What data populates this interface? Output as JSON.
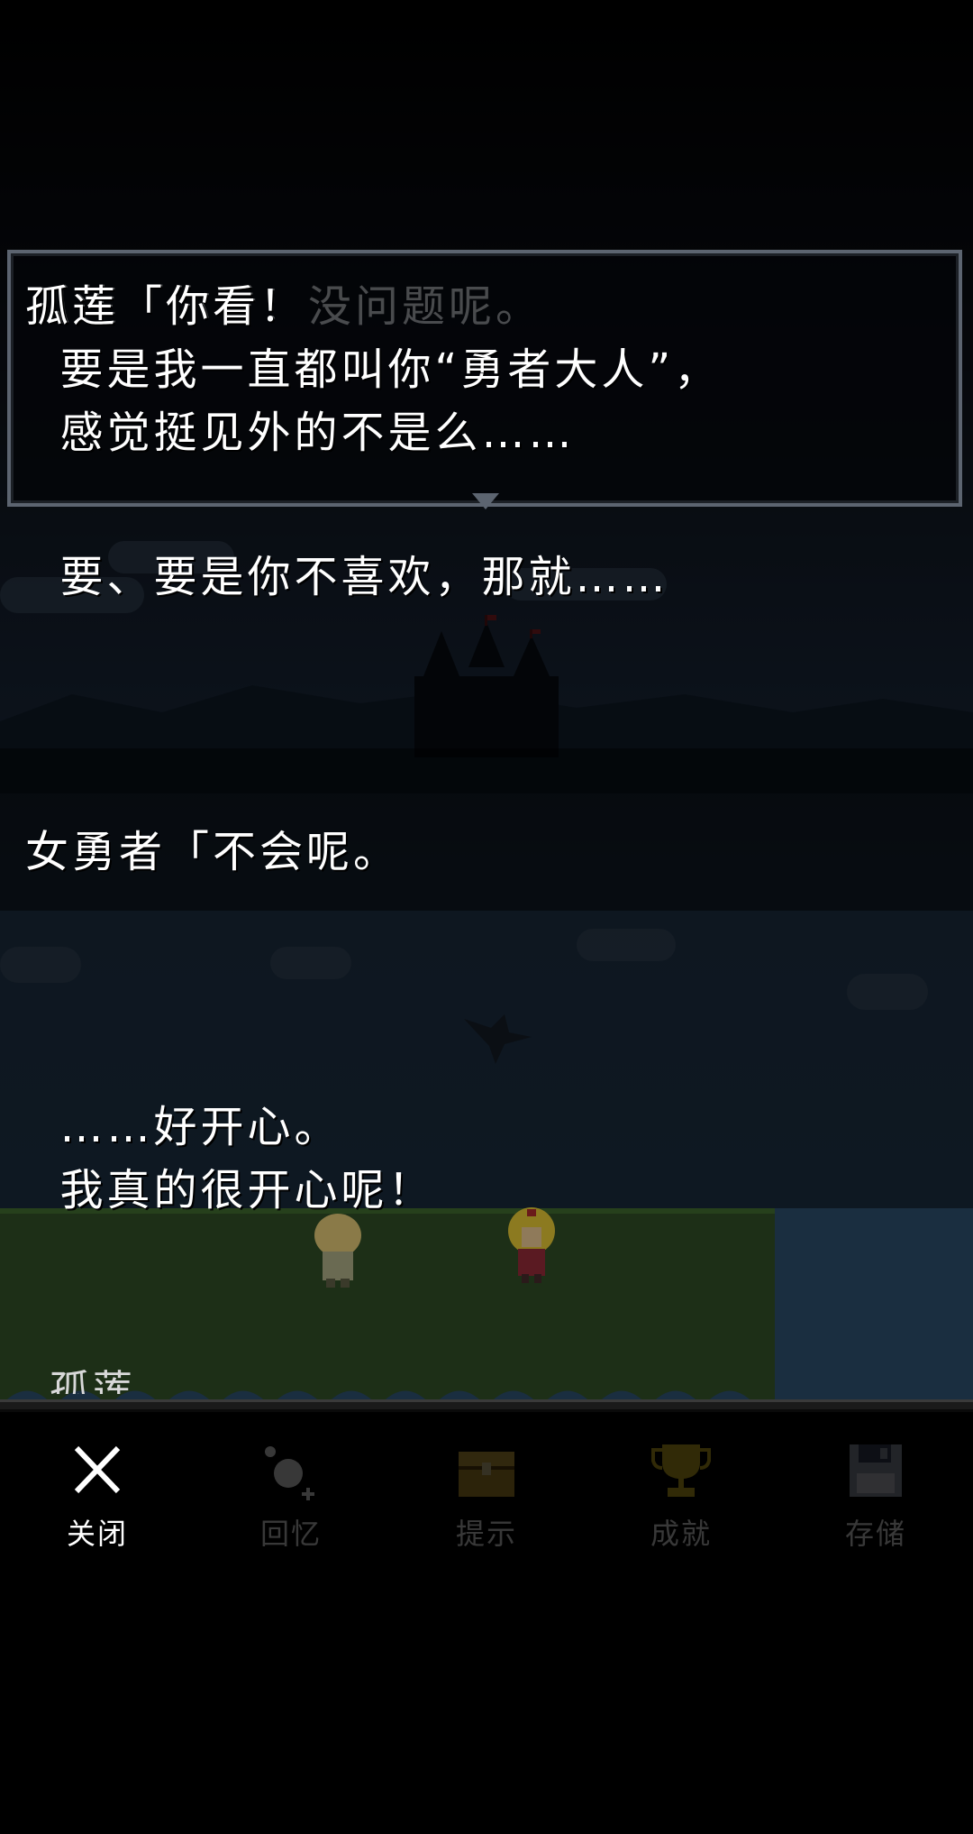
{
  "dialog": {
    "ghost_line": "孤莲「你看！没问题呢。",
    "box_line1": "孤莲「你看！",
    "box_line2": "  要是我一直都叫你“勇者大人”，",
    "box_line3": "  感觉挺见外的不是么……",
    "line_mid": "  要、要是你不喜欢，那就……",
    "hero_line": "女勇者「不会呢。",
    "happy_line1": "  ……好开心。",
    "happy_line2": "  我真的很开心呢！",
    "next_speaker_cut": "孤莲"
  },
  "menu": {
    "items": [
      {
        "label": "关闭",
        "icon": "close-icon",
        "enabled": true
      },
      {
        "label": "回忆",
        "icon": "memory-icon",
        "enabled": false
      },
      {
        "label": "提示",
        "icon": "hint-chest-icon",
        "enabled": false
      },
      {
        "label": "成就",
        "icon": "trophy-icon",
        "enabled": false
      },
      {
        "label": "存储",
        "icon": "save-floppy-icon",
        "enabled": false
      }
    ]
  },
  "colors": {
    "text": "#ffffff",
    "dialog_border": "#5c6470",
    "menu_bg": "#000000"
  }
}
